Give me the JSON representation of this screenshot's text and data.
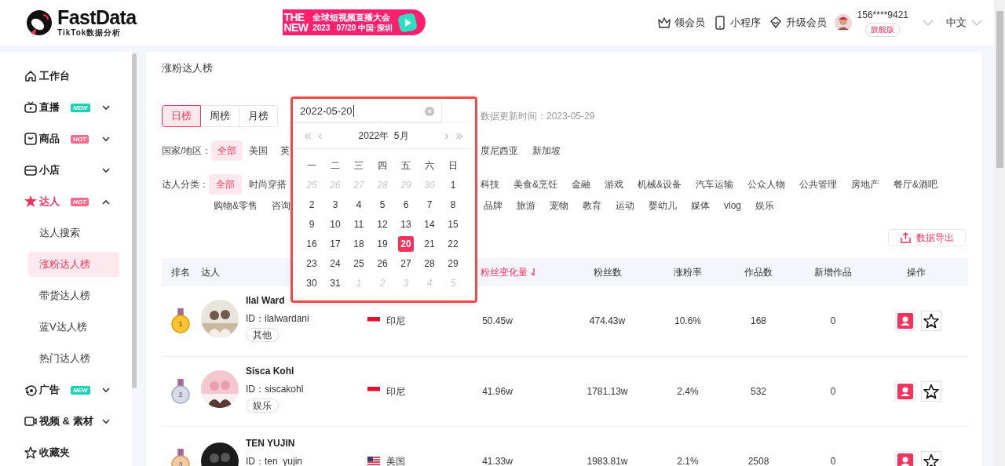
{
  "header": {
    "logo": {
      "name": "FastData",
      "subtitle": "TikTok数据分析"
    },
    "banner": {
      "headline_lines": [
        "THE",
        "NEW"
      ],
      "title": "全球短视频直播大会",
      "year": "2023",
      "date_place": "07/20 中国·深圳"
    },
    "nav": [
      {
        "kind": "crown",
        "label": "领会员"
      },
      {
        "kind": "phone",
        "label": "小程序"
      },
      {
        "kind": "diamond",
        "label": "升级会员"
      }
    ],
    "user": {
      "phone": "156****9421",
      "plan": "旗舰版"
    },
    "language": "中文"
  },
  "sidebar": {
    "items": [
      {
        "kind": "home",
        "label": "工作台",
        "selected": false
      },
      {
        "kind": "live",
        "label": "直播",
        "badge": {
          "text": "NEW",
          "color": "#19d3b4"
        },
        "expanded": false,
        "selected": false
      },
      {
        "kind": "goods",
        "label": "商品",
        "badge": {
          "text": "HOT",
          "color": "#ff6b8e"
        },
        "expanded": false,
        "selected": false
      },
      {
        "kind": "shop",
        "label": "小店",
        "expanded": false,
        "selected": false
      },
      {
        "kind": "star",
        "label": "达人",
        "badge": {
          "text": "HOT",
          "color": "#ff6b8e"
        },
        "expanded": true,
        "selected": true,
        "children": [
          {
            "label": "达人搜索",
            "selected": false
          },
          {
            "label": "涨粉达人榜",
            "selected": true
          },
          {
            "label": "带货达人榜",
            "selected": false
          },
          {
            "label": "蓝V达人榜",
            "selected": false
          },
          {
            "label": "热门达人榜",
            "selected": false
          }
        ]
      },
      {
        "kind": "ad",
        "label": "广告",
        "badge": {
          "text": "NEW",
          "color": "#19d3b4"
        },
        "expanded": false,
        "selected": false
      },
      {
        "kind": "video",
        "label": "视频 & 素材",
        "expanded": false,
        "selected": false
      },
      {
        "kind": "fav",
        "label": "收藏夹",
        "selected": false
      }
    ]
  },
  "page_title": "涨粉达人榜",
  "period_tabs": [
    {
      "label": "日榜",
      "selected": true
    },
    {
      "label": "周榜",
      "selected": false
    },
    {
      "label": "月榜",
      "selected": false
    }
  ],
  "update_time": "数据更新时间：2023-05-29",
  "date_picker": {
    "value": "2022-05-20",
    "month_label": "2022年  5月",
    "nav_prev": [
      "«",
      "‹"
    ],
    "nav_next": [
      "›",
      "»"
    ],
    "weekdays": [
      "一",
      "二",
      "三",
      "四",
      "五",
      "六",
      "日"
    ],
    "days": [
      {
        "label": "25",
        "in_month": false,
        "selected": false
      },
      {
        "label": "26",
        "in_month": false,
        "selected": false
      },
      {
        "label": "27",
        "in_month": false,
        "selected": false
      },
      {
        "label": "28",
        "in_month": false,
        "selected": false
      },
      {
        "label": "29",
        "in_month": false,
        "selected": false
      },
      {
        "label": "30",
        "in_month": false,
        "selected": false
      },
      {
        "label": "1",
        "in_month": true,
        "selected": false
      },
      {
        "label": "2",
        "in_month": true,
        "selected": false
      },
      {
        "label": "3",
        "in_month": true,
        "selected": false
      },
      {
        "label": "4",
        "in_month": true,
        "selected": false
      },
      {
        "label": "5",
        "in_month": true,
        "selected": false
      },
      {
        "label": "6",
        "in_month": true,
        "selected": false
      },
      {
        "label": "7",
        "in_month": true,
        "selected": false
      },
      {
        "label": "8",
        "in_month": true,
        "selected": false
      },
      {
        "label": "9",
        "in_month": true,
        "selected": false
      },
      {
        "label": "10",
        "in_month": true,
        "selected": false
      },
      {
        "label": "11",
        "in_month": true,
        "selected": false
      },
      {
        "label": "12",
        "in_month": true,
        "selected": false
      },
      {
        "label": "13",
        "in_month": true,
        "selected": false
      },
      {
        "label": "14",
        "in_month": true,
        "selected": false
      },
      {
        "label": "15",
        "in_month": true,
        "selected": false
      },
      {
        "label": "16",
        "in_month": true,
        "selected": false
      },
      {
        "label": "17",
        "in_month": true,
        "selected": false
      },
      {
        "label": "18",
        "in_month": true,
        "selected": false
      },
      {
        "label": "19",
        "in_month": true,
        "selected": false
      },
      {
        "label": "20",
        "in_month": true,
        "selected": true
      },
      {
        "label": "21",
        "in_month": true,
        "selected": false
      },
      {
        "label": "22",
        "in_month": true,
        "selected": false
      },
      {
        "label": "23",
        "in_month": true,
        "selected": false
      },
      {
        "label": "24",
        "in_month": true,
        "selected": false
      },
      {
        "label": "25",
        "in_month": true,
        "selected": false
      },
      {
        "label": "26",
        "in_month": true,
        "selected": false
      },
      {
        "label": "27",
        "in_month": true,
        "selected": false
      },
      {
        "label": "28",
        "in_month": true,
        "selected": false
      },
      {
        "label": "29",
        "in_month": true,
        "selected": false
      },
      {
        "label": "30",
        "in_month": true,
        "selected": false
      },
      {
        "label": "31",
        "in_month": true,
        "selected": false
      },
      {
        "label": "1",
        "in_month": false,
        "selected": false
      },
      {
        "label": "2",
        "in_month": false,
        "selected": false
      },
      {
        "label": "3",
        "in_month": false,
        "selected": false
      },
      {
        "label": "4",
        "in_month": false,
        "selected": false
      },
      {
        "label": "5",
        "in_month": false,
        "selected": false
      }
    ]
  },
  "filters": {
    "country": {
      "label": "国家/地区：",
      "options": [
        {
          "label": "全部",
          "selected": true
        },
        {
          "label": "美国",
          "selected": false
        },
        {
          "label": "英",
          "selected": false
        }
      ],
      "options_past_picker": [
        {
          "label": "度尼西亚",
          "selected": false
        },
        {
          "label": "新加坡",
          "selected": false
        }
      ]
    },
    "category": {
      "label": "达人分类：",
      "options": [
        {
          "label": "全部",
          "selected": true
        },
        {
          "label": "时尚穿搭",
          "selected": false
        }
      ],
      "options_past_picker": [
        {
          "label": "科技",
          "selected": false
        },
        {
          "label": "美食&烹饪",
          "selected": false
        },
        {
          "label": "金融",
          "selected": false
        },
        {
          "label": "游戏",
          "selected": false
        },
        {
          "label": "机械&设备",
          "selected": false
        },
        {
          "label": "汽车运输",
          "selected": false
        },
        {
          "label": "公众人物",
          "selected": false
        },
        {
          "label": "公共管理",
          "selected": false
        },
        {
          "label": "房地产",
          "selected": false
        },
        {
          "label": "餐厅&酒吧",
          "selected": false
        }
      ],
      "second_line": [
        {
          "label": "购物&零售",
          "selected": false
        },
        {
          "label": "咨询",
          "selected": false
        }
      ],
      "second_line_past_picker": [
        {
          "label": "品牌",
          "selected": false
        },
        {
          "label": "旅游",
          "selected": false
        },
        {
          "label": "宠物",
          "selected": false
        },
        {
          "label": "教育",
          "selected": false
        },
        {
          "label": "运动",
          "selected": false
        },
        {
          "label": "婴幼儿",
          "selected": false
        },
        {
          "label": "媒体",
          "selected": false
        },
        {
          "label": "vlog",
          "selected": false
        },
        {
          "label": "娱乐",
          "selected": false
        }
      ]
    }
  },
  "export_button": "数据导出",
  "table": {
    "columns": [
      {
        "label": "排名"
      },
      {
        "label": "达人"
      },
      {
        "label": "粉丝变化量",
        "sorted": true
      },
      {
        "label": "粉丝数"
      },
      {
        "label": "涨粉率"
      },
      {
        "label": "作品数"
      },
      {
        "label": "新增作品"
      },
      {
        "label": "操作"
      }
    ],
    "rows": [
      {
        "medal": {
          "kind": "gold",
          "rank": "1"
        },
        "name": "Ilal Ward",
        "id": "ID：ilalwardani",
        "tag": "其他",
        "country": {
          "kind": "id",
          "label": "印尼"
        },
        "fan_change": "50.45w",
        "fans": "474.43w",
        "growth_rate": "10.6%",
        "works": "168",
        "new_works": "0"
      },
      {
        "medal": {
          "kind": "silver",
          "rank": "2"
        },
        "name": "Sisca Kohl",
        "id": "ID：siscakohl",
        "tag": "娱乐",
        "country": {
          "kind": "id",
          "label": "印尼"
        },
        "fan_change": "41.96w",
        "fans": "1781.13w",
        "growth_rate": "2.4%",
        "works": "532",
        "new_works": "0"
      },
      {
        "medal": {
          "kind": "bronze",
          "rank": "3"
        },
        "name": "TEN YUJIN",
        "id": "ID：ten_yujin",
        "country": {
          "kind": "us",
          "label": "美国"
        },
        "fan_change": "41.33w",
        "fans": "1983.81w",
        "growth_rate": "2.1%",
        "works": "2508",
        "new_works": "0"
      }
    ]
  }
}
